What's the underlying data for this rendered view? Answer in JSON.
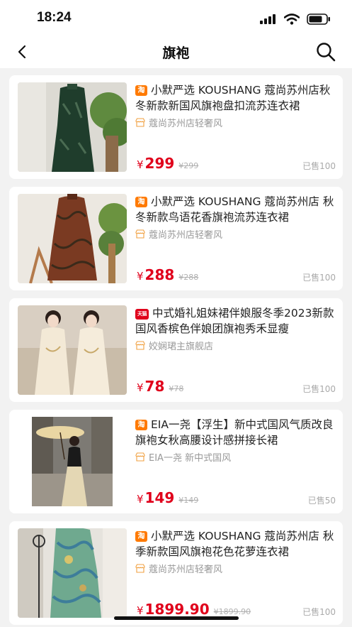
{
  "status": {
    "time": "18:24"
  },
  "nav": {
    "title": "旗袍"
  },
  "products": [
    {
      "platform": "淘",
      "title": "小默严选 KOUSHANG 蔻尚苏州店秋冬新款新国风旗袍盘扣流苏连衣裙",
      "shop": "蔻尚苏州店轻奢风",
      "currency": "¥",
      "price": "299",
      "original_price": "299",
      "sold": "已售100"
    },
    {
      "platform": "淘",
      "title": "小默严选 KOUSHANG 蔻尚苏州店 秋冬新款鸟语花香旗袍流苏连衣裙",
      "shop": "蔻尚苏州店轻奢风",
      "currency": "¥",
      "price": "288",
      "original_price": "288",
      "sold": "已售100"
    },
    {
      "platform": "天猫",
      "title": "中式婚礼姐妹裙伴娘服冬季2023新款国风香槟色伴娘团旗袍秀禾显瘦",
      "shop": "姣娴珺主旗舰店",
      "currency": "¥",
      "price": "78",
      "original_price": "78",
      "sold": "已售100"
    },
    {
      "platform": "淘",
      "title": "EIA一尧【浮生】新中式国风气质改良旗袍女秋高腰设计感拼接长裙",
      "shop": "EIA一尧 新中式国风",
      "currency": "¥",
      "price": "149",
      "original_price": "149",
      "sold": "已售50"
    },
    {
      "platform": "淘",
      "title": "小默严选 KOUSHANG 蔻尚苏州店 秋季新款国风旗袍花色花萝连衣裙",
      "shop": "蔻尚苏州店轻奢风",
      "currency": "¥",
      "price": "1899.90",
      "original_price": "1899.90",
      "sold": "已售100"
    }
  ],
  "colors": {
    "price": "#e0001b",
    "taobao_tag": "#ff7a00",
    "tmall_tag": "#e0001b"
  }
}
